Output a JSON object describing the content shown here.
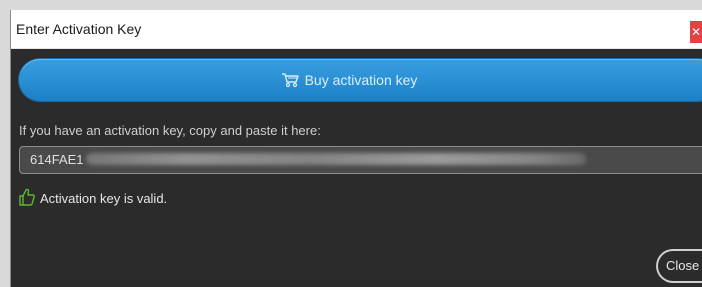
{
  "window": {
    "title": "Enter Activation Key"
  },
  "buy_button": {
    "label": "Buy activation key",
    "icon": "shopping-cart-icon"
  },
  "instruction": "If you have an activation key, copy and paste it here:",
  "key_field": {
    "visible_value": "614FAE1"
  },
  "status": {
    "text": "Activation key is valid.",
    "icon": "thumbs-up-icon",
    "color": "#5cb82e"
  },
  "close_button": {
    "label": "Close"
  },
  "colors": {
    "accent": "#1f88d0",
    "background": "#2b2b2b",
    "title_close": "#e04343"
  }
}
